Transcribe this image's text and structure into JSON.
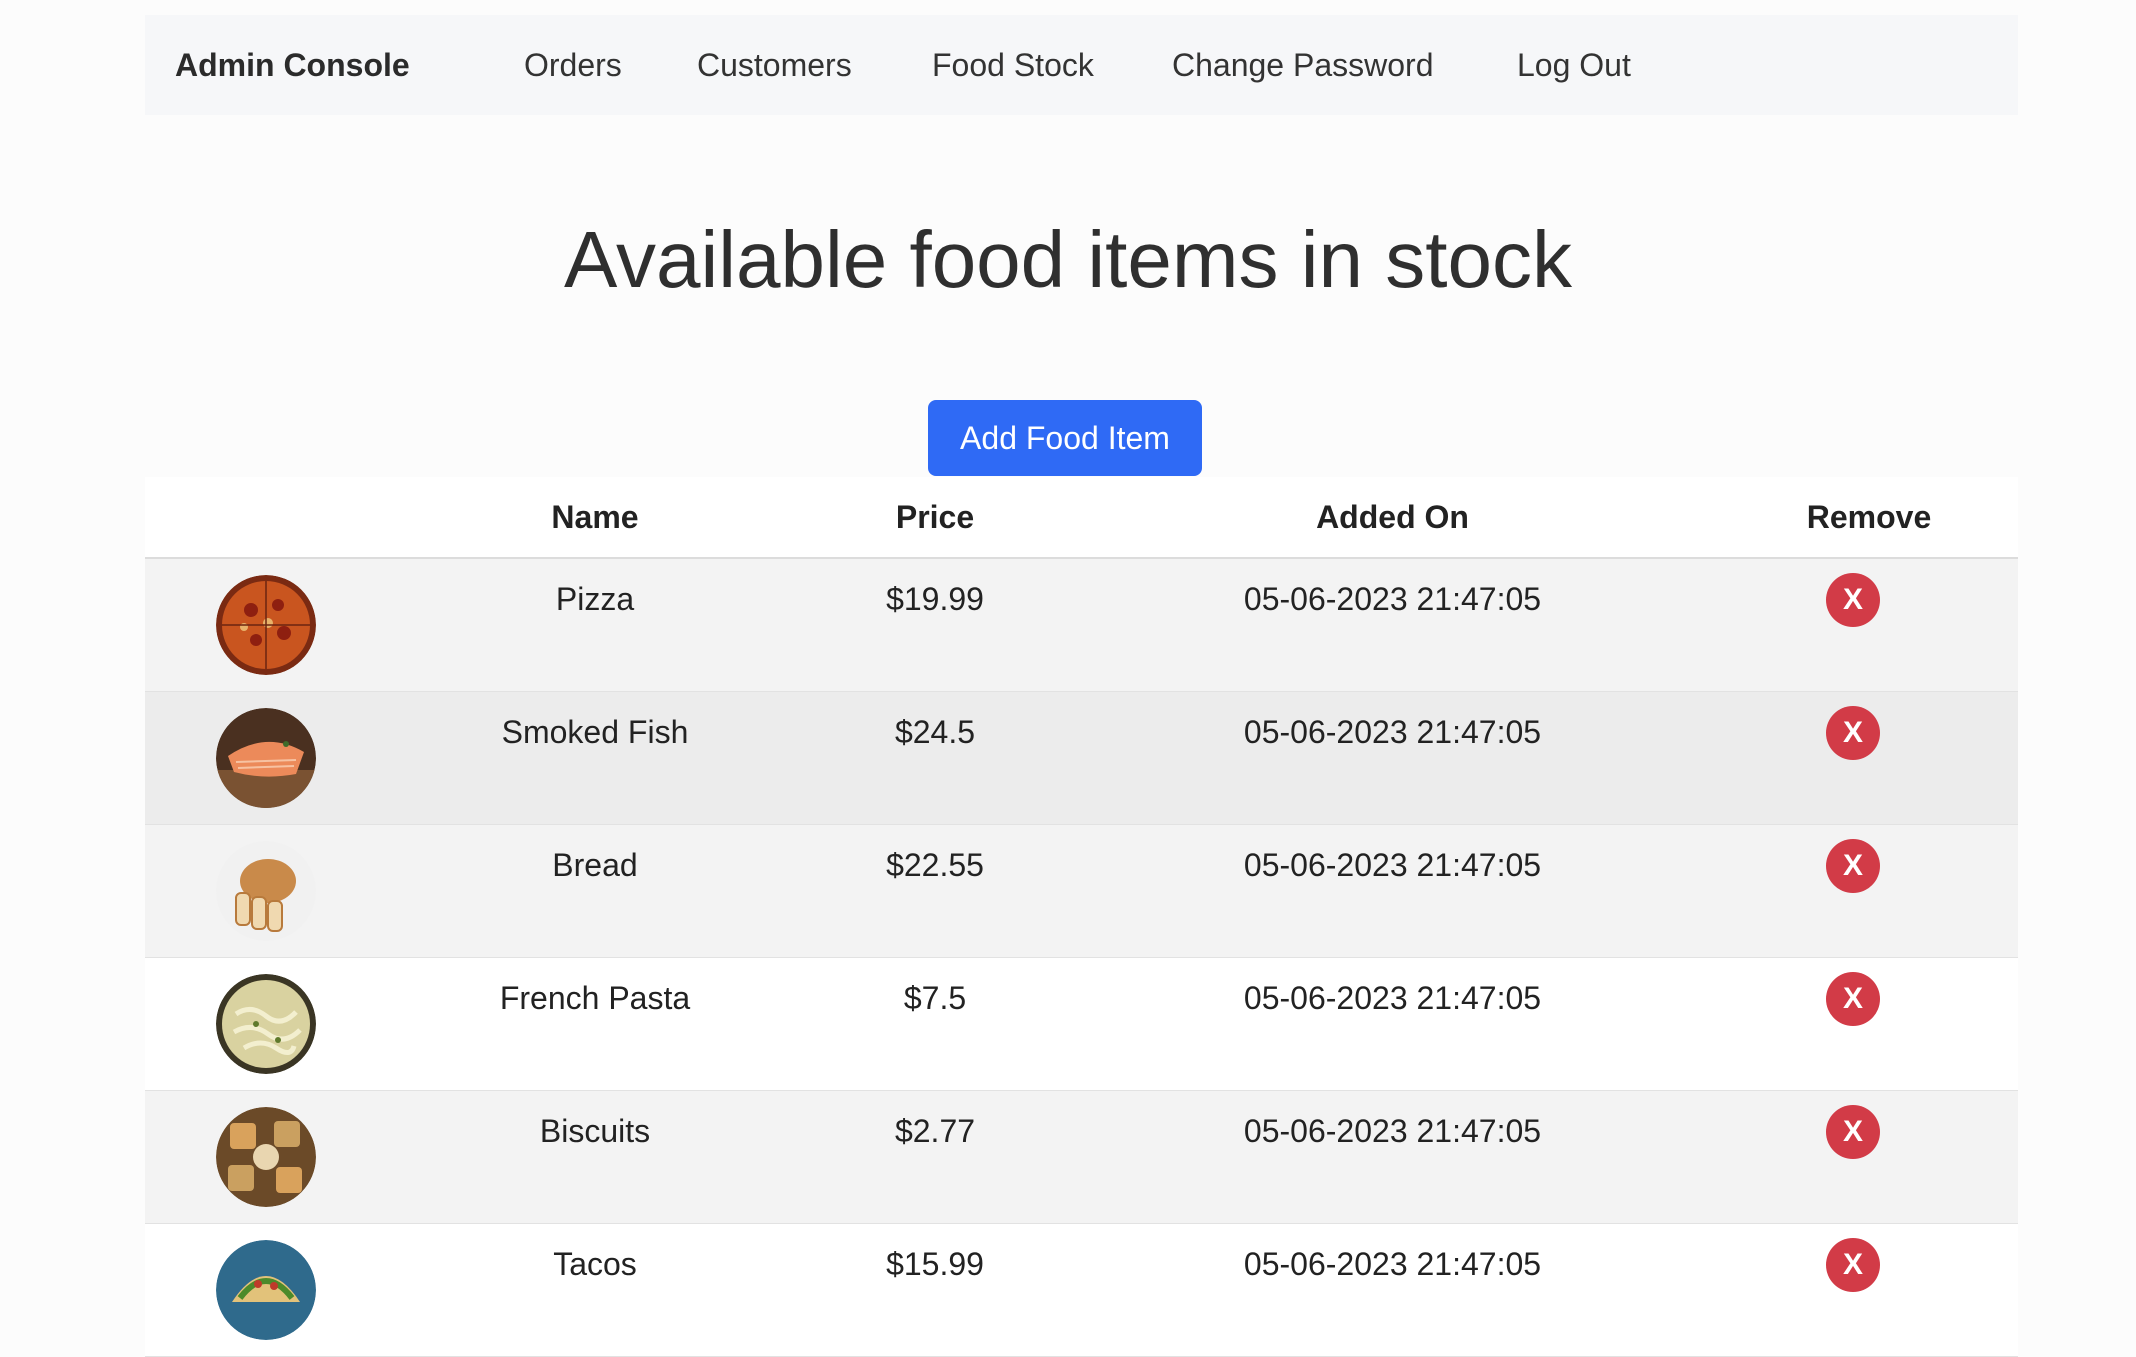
{
  "navbar": {
    "brand": "Admin Console",
    "links": [
      "Orders",
      "Customers",
      "Food Stock",
      "Change Password",
      "Log Out"
    ]
  },
  "page": {
    "title": "Available food items in stock",
    "add_button": "Add Food Item"
  },
  "table": {
    "headers": [
      "",
      "Name",
      "Price",
      "Added On",
      "Remove"
    ],
    "remove_label": "X",
    "rows": [
      {
        "name": "Pizza",
        "price": "$19.99",
        "added_on": "05-06-2023 21:47:05",
        "thumb_icon": "pizza-thumbnail"
      },
      {
        "name": "Smoked Fish",
        "price": "$24.5",
        "added_on": "05-06-2023 21:47:05",
        "thumb_icon": "smoked-fish-thumbnail"
      },
      {
        "name": "Bread",
        "price": "$22.55",
        "added_on": "05-06-2023 21:47:05",
        "thumb_icon": "bread-thumbnail"
      },
      {
        "name": "French Pasta",
        "price": "$7.5",
        "added_on": "05-06-2023 21:47:05",
        "thumb_icon": "pasta-thumbnail"
      },
      {
        "name": "Biscuits",
        "price": "$2.77",
        "added_on": "05-06-2023 21:47:05",
        "thumb_icon": "biscuits-thumbnail"
      },
      {
        "name": "Tacos",
        "price": "$15.99",
        "added_on": "05-06-2023 21:47:05",
        "thumb_icon": "tacos-thumbnail"
      }
    ]
  },
  "colors": {
    "primary": "#2f6af5",
    "danger": "#d23b47",
    "navbar_bg": "#f6f7f9"
  }
}
